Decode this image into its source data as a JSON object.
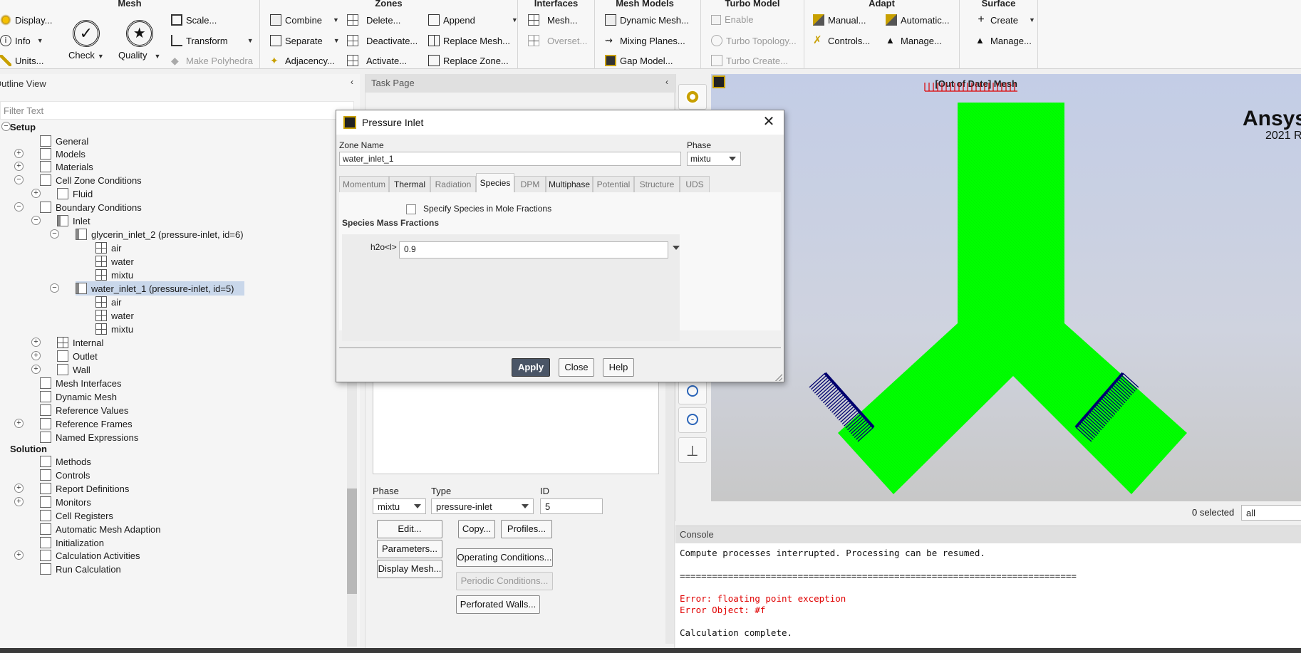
{
  "ribbon": {
    "groups": [
      {
        "title": "Mesh",
        "buttons": [
          "Display...",
          "Info",
          "Units...",
          "Check",
          "Quality",
          "Scale...",
          "Transform",
          "Make Polyhedra"
        ]
      },
      {
        "title": "Zones",
        "buttons": [
          "Combine",
          "Separate",
          "Adjacency...",
          "Delete...",
          "Deactivate...",
          "Activate...",
          "Append",
          "Replace Mesh...",
          "Replace Zone..."
        ]
      },
      {
        "title": "Interfaces",
        "buttons": [
          "Mesh...",
          "Overset..."
        ]
      },
      {
        "title": "Mesh Models",
        "buttons": [
          "Dynamic Mesh...",
          "Mixing Planes...",
          "Gap Model..."
        ]
      },
      {
        "title": "Turbo Model",
        "buttons": [
          "Enable",
          "Turbo Topology...",
          "Turbo Create..."
        ]
      },
      {
        "title": "Adapt",
        "buttons": [
          "Manual...",
          "Automatic...",
          "Controls...",
          "Manage..."
        ]
      },
      {
        "title": "Surface",
        "buttons": [
          "Create",
          "Manage..."
        ]
      }
    ]
  },
  "outline": {
    "title": "Outline View",
    "filter_placeholder": "Filter Text",
    "items": [
      "Setup",
      "General",
      "Models",
      "Materials",
      "Cell Zone Conditions",
      "Fluid",
      "Boundary Conditions",
      "Inlet",
      "glycerin_inlet_2 (pressure-inlet, id=6)",
      "air",
      "water",
      "mixtu",
      "water_inlet_1 (pressure-inlet, id=5)",
      "air",
      "water",
      "mixtu",
      "Internal",
      "Outlet",
      "Wall",
      "Mesh Interfaces",
      "Dynamic Mesh",
      "Reference Values",
      "Reference Frames",
      "Named Expressions",
      "Solution",
      "Methods",
      "Controls",
      "Report Definitions",
      "Monitors",
      "Cell Registers",
      "Automatic Mesh Adaption",
      "Initialization",
      "Calculation Activities",
      "Run Calculation"
    ]
  },
  "task_page": {
    "title": "Task Page",
    "phase_label": "Phase",
    "phase_value": "mixtu",
    "type_label": "Type",
    "type_value": "pressure-inlet",
    "id_label": "ID",
    "id_value": "5",
    "buttons": {
      "edit": "Edit...",
      "copy": "Copy...",
      "profiles": "Profiles...",
      "parameters": "Parameters...",
      "operating": "Operating Conditions...",
      "display_mesh": "Display Mesh...",
      "periodic": "Periodic Conditions...",
      "perforated": "Perforated Walls..."
    }
  },
  "graphics": {
    "title": "[Out of Date] Mesh",
    "brand": "Ansys",
    "brand_sub": "2021 R",
    "mesh_color": "#00ff00",
    "selected_text": "0 selected",
    "selection_value": "all"
  },
  "console": {
    "title": "Console",
    "lines": [
      "Compute processes interrupted. Processing can be resumed.",
      "",
      "==========================================================================",
      "",
      "Error: floating point exception",
      "Error Object: #f",
      "",
      "Calculation complete."
    ]
  },
  "dialog": {
    "title": "Pressure Inlet",
    "zone_name_label": "Zone Name",
    "zone_name_value": "water_inlet_1",
    "phase_label": "Phase",
    "phase_value": "mixtu",
    "tabs": [
      "Momentum",
      "Thermal",
      "Radiation",
      "Species",
      "DPM",
      "Multiphase",
      "Potential",
      "Structure",
      "UDS"
    ],
    "active_tab": "Species",
    "mole_fraction_checkbox": "Specify Species in Mole Fractions",
    "section_label": "Species Mass Fractions",
    "species_label": "h2o<l>",
    "species_value": "0.9",
    "apply": "Apply",
    "close": "Close",
    "help": "Help"
  }
}
